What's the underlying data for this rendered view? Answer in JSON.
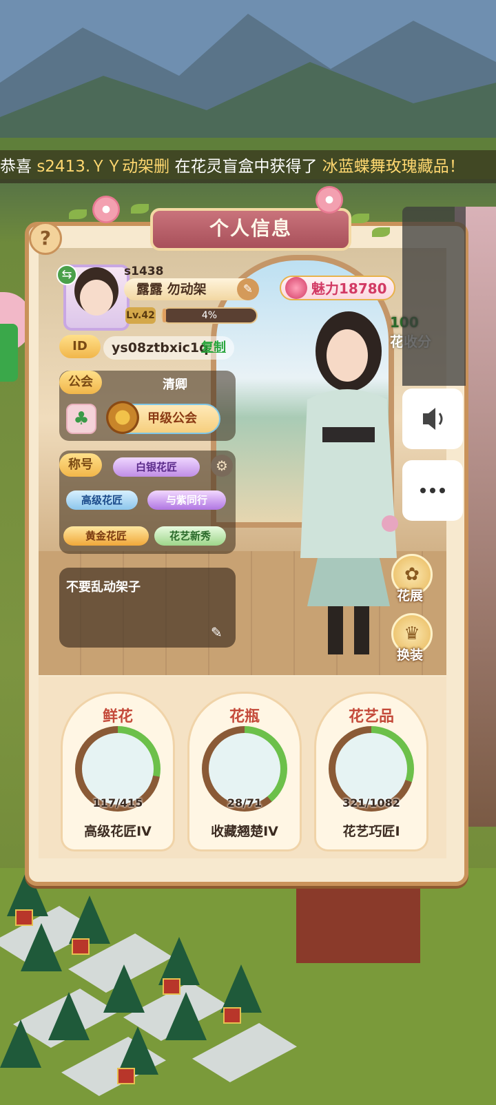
{
  "ticker": {
    "prefix": "恭喜",
    "player": "s2413.ＹＹ动架删",
    "middle": "在花灵盲盒中获得了",
    "item": "冰蓝蝶舞玫瑰藏品！"
  },
  "panel": {
    "title": "个人信息",
    "help_symbol": "?"
  },
  "profile": {
    "server": "s1438",
    "name": "露露 勿动架",
    "level": "Lv.42",
    "exp_percent_text": "4%",
    "exp_fraction": 0.04,
    "charm_text": "魅力18780",
    "id_label": "ID",
    "id_value": "ys08ztbxic1q",
    "copy_label": "复制"
  },
  "guild": {
    "label": "公会",
    "leader": "清卿",
    "name": "甲级公会"
  },
  "titles": {
    "label": "称号",
    "items": [
      "白银花匠",
      "高级花匠",
      "与紫同行",
      "黄金花匠",
      "花艺新秀"
    ]
  },
  "signature": "不要乱动架子",
  "side": {
    "flower_show": "花展",
    "dress_up": "换装",
    "score_fragment": "100",
    "score_label": "花收分"
  },
  "collections": [
    {
      "title": "鲜花",
      "count": "117/415",
      "rank": "高级花匠IV",
      "progress": 0.28
    },
    {
      "title": "花瓶",
      "count": "28/71",
      "rank": "收藏翘楚IV",
      "progress": 0.39
    },
    {
      "title": "花艺品",
      "count": "321/1082",
      "rank": "花艺巧匠I",
      "progress": 0.3
    }
  ],
  "colors": {
    "accent": "#c44a3a",
    "progress": "#6cc04a",
    "charm": "#d23a64",
    "copy": "#27a43a"
  },
  "icons": [
    "question-icon",
    "swap-icon",
    "edit-icon",
    "rose-icon",
    "clover-icon",
    "wheel-icon",
    "gear-icon",
    "flower-icon",
    "dress-icon",
    "speaker-icon",
    "more-icon"
  ]
}
